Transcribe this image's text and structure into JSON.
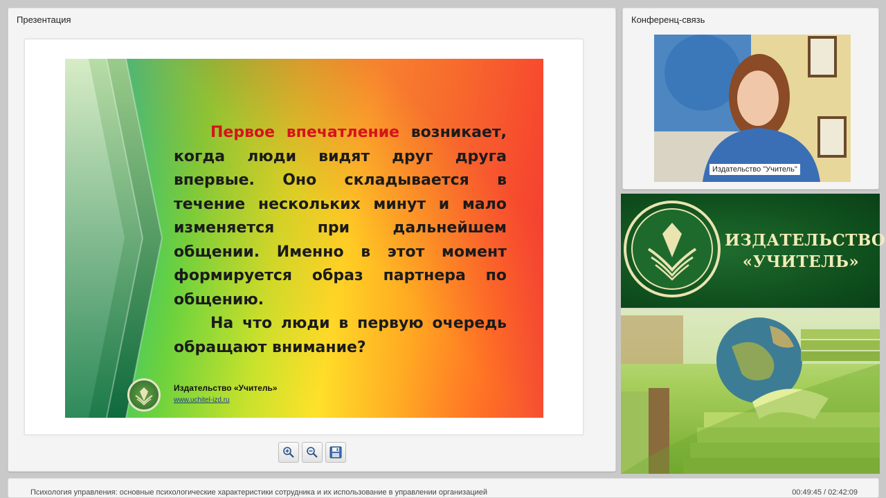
{
  "presentation": {
    "title": "Презентация",
    "slide": {
      "highlight": "Первое впечатление",
      "line1_rest": " возникает, когда люди видят друг друга впервые. Оно складывается в течение нескольких минут и мало изменяется при дальнейшем общении. Именно в этот момент формируется образ партнера по общению.",
      "line2": "На что люди в первую очередь обращают внимание?",
      "publisher": "Издательство «Учитель»",
      "url": "www.uchitel-izd.ru"
    },
    "toolbar": {
      "zoom_in_icon": "zoom-in-icon",
      "zoom_out_icon": "zoom-out-icon",
      "save_icon": "floppy-disk-icon"
    }
  },
  "conference": {
    "title": "Конференц-связь",
    "video_caption": "Издательство \"Учитель\""
  },
  "brand": {
    "line1": "ИЗДАТЕЛЬСТВО",
    "line2": "«УЧИТЕЛЬ»"
  },
  "footer": {
    "title": "Психология управления: основные психологические характеристики сотрудника и их использование в управлении организацией",
    "time": "00:49:45 / 02:42:09"
  },
  "colors": {
    "highlight": "#d4141a",
    "brand_green": "#0e4d1c",
    "brand_text": "#f1ecb6"
  }
}
